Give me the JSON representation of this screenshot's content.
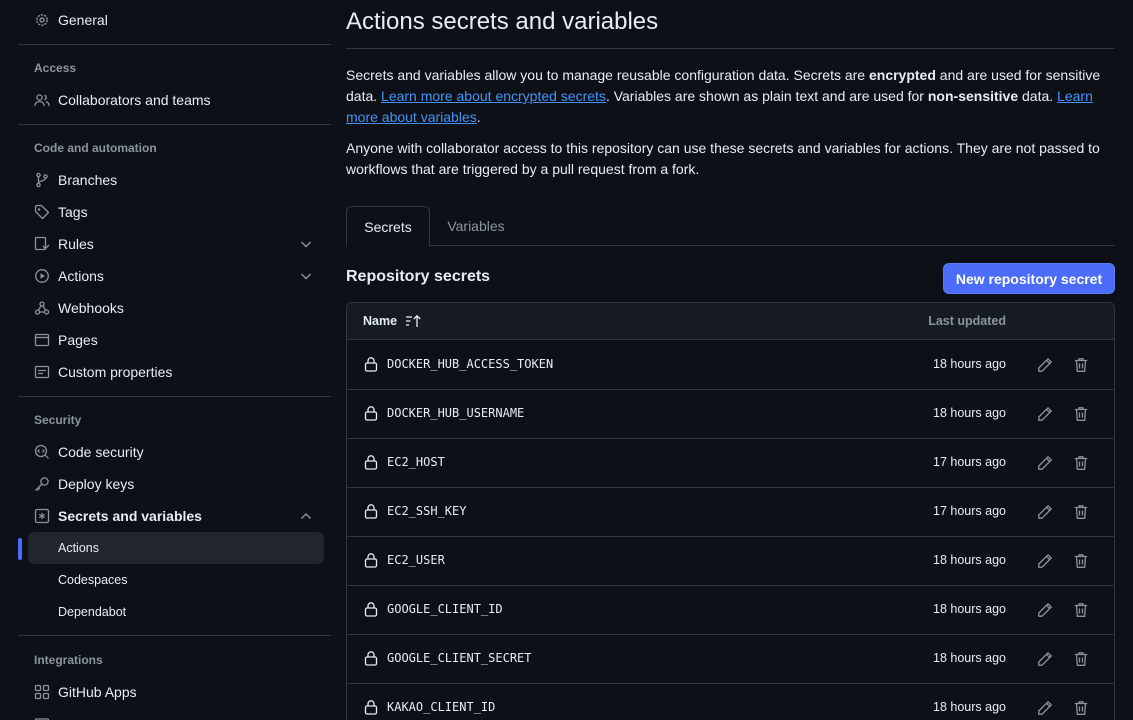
{
  "sidebar": {
    "general": "General",
    "access_title": "Access",
    "collaborators": "Collaborators and teams",
    "code_automation_title": "Code and automation",
    "branches": "Branches",
    "tags": "Tags",
    "rules": "Rules",
    "actions": "Actions",
    "webhooks": "Webhooks",
    "pages": "Pages",
    "custom_properties": "Custom properties",
    "security_title": "Security",
    "code_security": "Code security",
    "deploy_keys": "Deploy keys",
    "secrets_variables": "Secrets and variables",
    "sub_actions": "Actions",
    "sub_codespaces": "Codespaces",
    "sub_dependabot": "Dependabot",
    "integrations_title": "Integrations",
    "github_apps": "GitHub Apps"
  },
  "main": {
    "title": "Actions secrets and variables",
    "intro": {
      "t1": "Secrets and variables allow you to manage reusable configuration data. Secrets are ",
      "b1": "encrypted",
      "t2": " and are used for sensitive data. ",
      "link1": "Learn more about encrypted secrets",
      "t3": ". Variables are shown as plain text and are used for ",
      "b2": "non-sensitive",
      "t4": " data. ",
      "link2": "Learn more about variables",
      "t5": "."
    },
    "access_note": "Anyone with collaborator access to this repository can use these secrets and variables for actions. They are not passed to workflows that are triggered by a pull request from a fork.",
    "tabs": [
      "Secrets",
      "Variables"
    ],
    "section_title": "Repository secrets",
    "new_button": "New repository secret",
    "table": {
      "col_name": "Name",
      "col_updated": "Last updated",
      "rows": [
        {
          "name": "DOCKER_HUB_ACCESS_TOKEN",
          "updated": "18 hours ago"
        },
        {
          "name": "DOCKER_HUB_USERNAME",
          "updated": "18 hours ago"
        },
        {
          "name": "EC2_HOST",
          "updated": "17 hours ago"
        },
        {
          "name": "EC2_SSH_KEY",
          "updated": "17 hours ago"
        },
        {
          "name": "EC2_USER",
          "updated": "18 hours ago"
        },
        {
          "name": "GOOGLE_CLIENT_ID",
          "updated": "18 hours ago"
        },
        {
          "name": "GOOGLE_CLIENT_SECRET",
          "updated": "18 hours ago"
        },
        {
          "name": "KAKAO_CLIENT_ID",
          "updated": "18 hours ago"
        }
      ]
    }
  },
  "colors": {
    "background": "#0d1117",
    "accent": "#4a6cf7",
    "link": "#4493f8",
    "border": "#30363d",
    "muted": "#8b949e"
  }
}
